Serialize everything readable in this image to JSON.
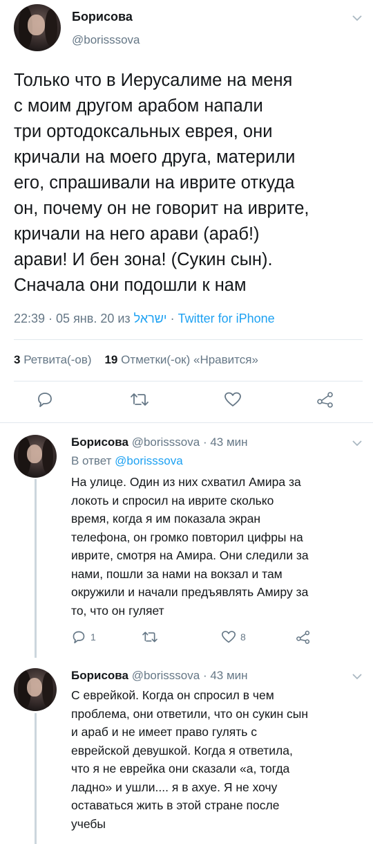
{
  "main_tweet": {
    "author_name": "Борисова",
    "author_handle": "@borisssova",
    "text": "Только что в Иерусалиме на меня\nс моим другом арабом напали\nтри ортодоксальных еврея, они\nкричали на моего друга, материли\nего, спрашивали на иврите откуда\nон, почему он не говорит на иврите,\nкричали на него арави (араб!)\nарави! И бен зона! (Сукин сын).\nСначала они подошли к нам",
    "time": "22:39 · 05 янв. 20 из ",
    "location": "ישראל",
    "separator": " · ",
    "source": "Twitter for iPhone",
    "retweets_count": "3",
    "retweets_label": "Ретвита(-ов)",
    "likes_count": "19",
    "likes_label": "Отметки(-ок) «Нравится»"
  },
  "replies": [
    {
      "author_name": "Борисова",
      "author_handle": "@borisssova",
      "time": "43 мин",
      "reply_prefix": "В ответ ",
      "reply_to": "@borisssova",
      "text": "На улице. Один из них схватил Амира за\nлокоть и спросил на иврите сколько\nвремя, когда я им показала экран\nтелефона, он громко повторил цифры на\nиврите, смотря на Амира. Они следили за\nнами, пошли за нами на вокзал и там\nокружили и начали предъявлять Амиру за\nто, что он гуляет",
      "reply_count": "1",
      "like_count": "8"
    },
    {
      "author_name": "Борисова",
      "author_handle": "@borisssova",
      "time": "43 мин",
      "text": "С еврейкой. Когда он спросил в чем\nпроблема, они ответили, что он сукин сын\nи араб и не имеет право гулять с\nеврейской девушкой.  Когда я ответила,\nчто я не еврейка они сказали «а, тогда\nладно» и ушли.... я в ахуе. Я не хочу\nоставаться жить в этой стране после\nучебы"
    }
  ],
  "colors": {
    "text": "#14171a",
    "secondary": "#657786",
    "link": "#1da1f2",
    "divider": "#e1e8ed"
  }
}
